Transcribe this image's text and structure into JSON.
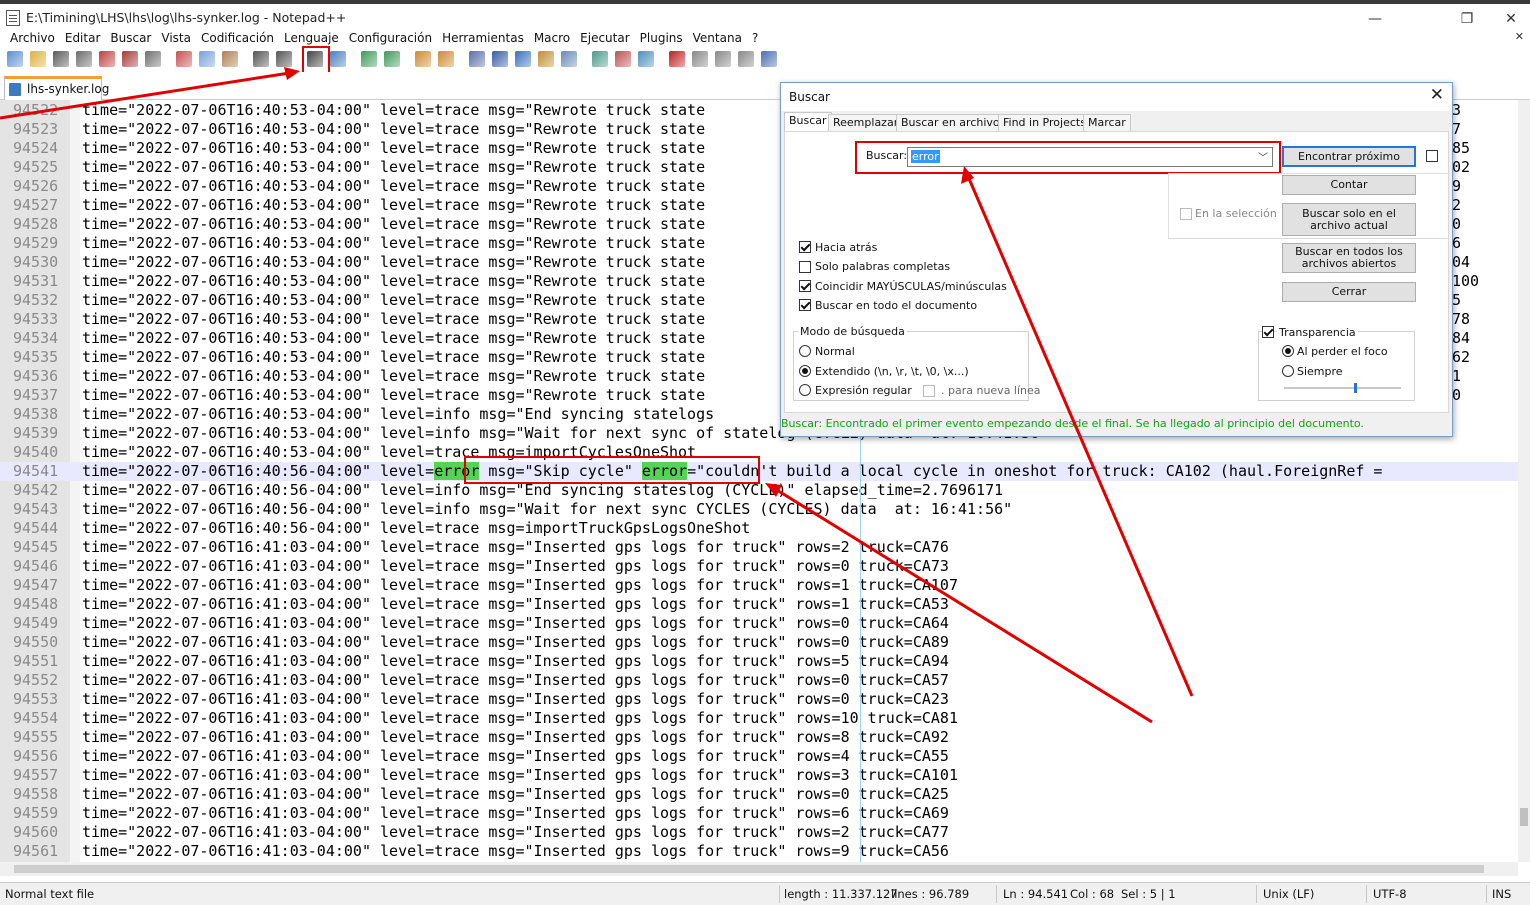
{
  "window": {
    "title": "E:\\Timining\\LHS\\lhs\\log\\lhs-synker.log - Notepad++",
    "minimize_glyph": "—",
    "restore_glyph": "❐",
    "close_glyph": "✕"
  },
  "menu": [
    "Archivo",
    "Editar",
    "Buscar",
    "Vista",
    "Codificación",
    "Lenguaje",
    "Configuración",
    "Herramientas",
    "Macro",
    "Ejecutar",
    "Plugins",
    "Ventana",
    "?"
  ],
  "toolbar": {
    "icons": [
      "new-file-icon",
      "open-file-icon",
      "save-icon",
      "save-all-icon",
      "close-icon",
      "close-all-icon",
      "print-icon",
      "cut-icon",
      "copy-icon",
      "paste-icon",
      "undo-icon",
      "redo-icon",
      "find-icon",
      "replace-icon",
      "zoom-in-icon",
      "zoom-out-icon",
      "sync-vertical-icon",
      "sync-horizontal-icon",
      "word-wrap-icon",
      "show-all-chars-icon",
      "indent-guide-icon",
      "define-language-icon",
      "document-map-icon",
      "function-list-icon",
      "folder-as-workspace-icon",
      "monitoring-icon",
      "record-macro-icon",
      "stop-macro-icon",
      "play-macro-icon",
      "play-multiple-icon",
      "save-macro-icon"
    ],
    "cross_glyph": "✕"
  },
  "tabs": [
    {
      "label": "lhs-synker.log"
    }
  ],
  "editor": {
    "lines": [
      {
        "num": "94522",
        "text": "time=\"2022-07-06T16:40:53-04:00\" level=trace msg=\"Rewrote truck state",
        "tail": "3"
      },
      {
        "num": "94523",
        "text": "time=\"2022-07-06T16:40:53-04:00\" level=trace msg=\"Rewrote truck state",
        "tail": "7"
      },
      {
        "num": "94524",
        "text": "time=\"2022-07-06T16:40:53-04:00\" level=trace msg=\"Rewrote truck state",
        "tail": "85"
      },
      {
        "num": "94525",
        "text": "time=\"2022-07-06T16:40:53-04:00\" level=trace msg=\"Rewrote truck state",
        "tail": "02"
      },
      {
        "num": "94526",
        "text": "time=\"2022-07-06T16:40:53-04:00\" level=trace msg=\"Rewrote truck state",
        "tail": "9"
      },
      {
        "num": "94527",
        "text": "time=\"2022-07-06T16:40:53-04:00\" level=trace msg=\"Rewrote truck state",
        "tail": "2"
      },
      {
        "num": "94528",
        "text": "time=\"2022-07-06T16:40:53-04:00\" level=trace msg=\"Rewrote truck state",
        "tail": "0"
      },
      {
        "num": "94529",
        "text": "time=\"2022-07-06T16:40:53-04:00\" level=trace msg=\"Rewrote truck state",
        "tail": "6"
      },
      {
        "num": "94530",
        "text": "time=\"2022-07-06T16:40:53-04:00\" level=trace msg=\"Rewrote truck state",
        "tail": "04"
      },
      {
        "num": "94531",
        "text": "time=\"2022-07-06T16:40:53-04:00\" level=trace msg=\"Rewrote truck state",
        "tail": "100"
      },
      {
        "num": "94532",
        "text": "time=\"2022-07-06T16:40:53-04:00\" level=trace msg=\"Rewrote truck state",
        "tail": "5"
      },
      {
        "num": "94533",
        "text": "time=\"2022-07-06T16:40:53-04:00\" level=trace msg=\"Rewrote truck state",
        "tail": "78"
      },
      {
        "num": "94534",
        "text": "time=\"2022-07-06T16:40:53-04:00\" level=trace msg=\"Rewrote truck state",
        "tail": "84"
      },
      {
        "num": "94535",
        "text": "time=\"2022-07-06T16:40:53-04:00\" level=trace msg=\"Rewrote truck state",
        "tail": "62"
      },
      {
        "num": "94536",
        "text": "time=\"2022-07-06T16:40:53-04:00\" level=trace msg=\"Rewrote truck state",
        "tail": "1"
      },
      {
        "num": "94537",
        "text": "time=\"2022-07-06T16:40:53-04:00\" level=trace msg=\"Rewrote truck state",
        "tail": "0"
      },
      {
        "num": "94538",
        "text": "time=\"2022-07-06T16:40:53-04:00\" level=info msg=\"End syncing statelogs",
        "tail": ""
      },
      {
        "num": "94539",
        "text": "time=\"2022-07-06T16:40:53-04:00\" level=info msg=\"Wait for next sync of statelog (CYCLE) data  at: 16:41:56\"",
        "tail": ""
      },
      {
        "num": "94540",
        "text": "time=\"2022-07-06T16:40:53-04:00\" level=trace msg=importCyclesOneShot",
        "tail": ""
      },
      {
        "num": "94541",
        "pre": "time=\"2022-07-06T16:40:56-04:00\" level=",
        "hl1": "error",
        "mid": " msg=\"Skip cycle\" ",
        "hl2": "error",
        "post": "=\"couldn't build a local cycle in oneshot for truck: CA102 (haul.ForeignRef =",
        "current": true
      },
      {
        "num": "94542",
        "text": "time=\"2022-07-06T16:40:56-04:00\" level=info msg=\"End syncing stateslog (CYCLE)\" elapsed_time=2.7696171",
        "tail": ""
      },
      {
        "num": "94543",
        "text": "time=\"2022-07-06T16:40:56-04:00\" level=info msg=\"Wait for next sync CYCLES (CYCLES) data  at: 16:41:56\"",
        "tail": ""
      },
      {
        "num": "94544",
        "text": "time=\"2022-07-06T16:40:56-04:00\" level=trace msg=importTruckGpsLogsOneShot",
        "tail": ""
      },
      {
        "num": "94545",
        "text": "time=\"2022-07-06T16:41:03-04:00\" level=trace msg=\"Inserted gps logs for truck\" rows=2 truck=CA76",
        "tail": ""
      },
      {
        "num": "94546",
        "text": "time=\"2022-07-06T16:41:03-04:00\" level=trace msg=\"Inserted gps logs for truck\" rows=0 truck=CA73",
        "tail": ""
      },
      {
        "num": "94547",
        "text": "time=\"2022-07-06T16:41:03-04:00\" level=trace msg=\"Inserted gps logs for truck\" rows=1 truck=CA107",
        "tail": ""
      },
      {
        "num": "94548",
        "text": "time=\"2022-07-06T16:41:03-04:00\" level=trace msg=\"Inserted gps logs for truck\" rows=1 truck=CA53",
        "tail": ""
      },
      {
        "num": "94549",
        "text": "time=\"2022-07-06T16:41:03-04:00\" level=trace msg=\"Inserted gps logs for truck\" rows=0 truck=CA64",
        "tail": ""
      },
      {
        "num": "94550",
        "text": "time=\"2022-07-06T16:41:03-04:00\" level=trace msg=\"Inserted gps logs for truck\" rows=0 truck=CA89",
        "tail": ""
      },
      {
        "num": "94551",
        "text": "time=\"2022-07-06T16:41:03-04:00\" level=trace msg=\"Inserted gps logs for truck\" rows=5 truck=CA94",
        "tail": ""
      },
      {
        "num": "94552",
        "text": "time=\"2022-07-06T16:41:03-04:00\" level=trace msg=\"Inserted gps logs for truck\" rows=0 truck=CA57",
        "tail": ""
      },
      {
        "num": "94553",
        "text": "time=\"2022-07-06T16:41:03-04:00\" level=trace msg=\"Inserted gps logs for truck\" rows=0 truck=CA23",
        "tail": ""
      },
      {
        "num": "94554",
        "text": "time=\"2022-07-06T16:41:03-04:00\" level=trace msg=\"Inserted gps logs for truck\" rows=10 truck=CA81",
        "tail": ""
      },
      {
        "num": "94555",
        "text": "time=\"2022-07-06T16:41:03-04:00\" level=trace msg=\"Inserted gps logs for truck\" rows=8 truck=CA92",
        "tail": ""
      },
      {
        "num": "94556",
        "text": "time=\"2022-07-06T16:41:03-04:00\" level=trace msg=\"Inserted gps logs for truck\" rows=4 truck=CA55",
        "tail": ""
      },
      {
        "num": "94557",
        "text": "time=\"2022-07-06T16:41:03-04:00\" level=trace msg=\"Inserted gps logs for truck\" rows=3 truck=CA101",
        "tail": ""
      },
      {
        "num": "94558",
        "text": "time=\"2022-07-06T16:41:03-04:00\" level=trace msg=\"Inserted gps logs for truck\" rows=0 truck=CA25",
        "tail": ""
      },
      {
        "num": "94559",
        "text": "time=\"2022-07-06T16:41:03-04:00\" level=trace msg=\"Inserted gps logs for truck\" rows=6 truck=CA69",
        "tail": ""
      },
      {
        "num": "94560",
        "text": "time=\"2022-07-06T16:41:03-04:00\" level=trace msg=\"Inserted gps logs for truck\" rows=2 truck=CA77",
        "tail": ""
      },
      {
        "num": "94561",
        "text": "time=\"2022-07-06T16:41:03-04:00\" level=trace msg=\"Inserted gps logs for truck\" rows=9 truck=CA56",
        "tail": ""
      }
    ]
  },
  "status": {
    "file_type": "Normal text file",
    "length": "length : 11.337.127",
    "lines": "lines : 96.789",
    "ln": "Ln : 94.541",
    "col": "Col : 68",
    "sel": "Sel : 5 | 1",
    "eol": "Unix (LF)",
    "encoding": "UTF-8",
    "mode": "INS"
  },
  "dialog": {
    "title": "Buscar",
    "close_glyph": "✕",
    "tabs": [
      "Buscar",
      "Reemplazar",
      "Buscar en archivos",
      "Find in Projects",
      "Marcar"
    ],
    "find_label": "Buscar:",
    "find_value": "error",
    "combo_arrow": "﹀",
    "buttons": {
      "find_next": "Encontrar próximo",
      "count": "Contar",
      "find_current": "Buscar solo en el archivo actual",
      "find_all_open": "Buscar en todos los archivos abiertos",
      "close": "Cerrar"
    },
    "in_selection": "En la selección",
    "options": {
      "backward": {
        "label": "Hacia atrás",
        "checked": true
      },
      "whole_word": {
        "label": "Solo palabras completas",
        "checked": false
      },
      "match_case": {
        "label": "Coincidir MAYÚSCULAS/minúsculas",
        "checked": true
      },
      "wrap": {
        "label": "Buscar en todo el documento",
        "checked": true
      }
    },
    "search_mode": {
      "title": "Modo de búsqueda",
      "normal": "Normal",
      "extended": "Extendido (\\n, \\r, \\t, \\0, \\x...)",
      "regex": "Expresión regular",
      "dot_newline": ". para nueva línea",
      "selected": "extended"
    },
    "transparency": {
      "label": "Transparencia",
      "checked": true,
      "on_lose_focus": "Al perder el foco",
      "always": "Siempre",
      "selected": "on_lose_focus",
      "level": 0.6
    },
    "status_message": "Buscar: Encontrado el primer evento empezando desde el final. Se ha llegado al principio del documento."
  },
  "colors": {
    "annotation": "#e00000",
    "match_highlight": "#56d256",
    "status_ok": "#12a012"
  }
}
